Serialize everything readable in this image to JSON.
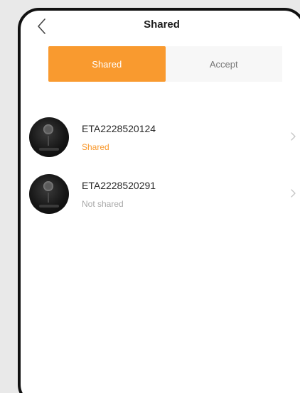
{
  "header": {
    "title": "Shared",
    "back_icon": "chevron-left-icon"
  },
  "tabs": [
    {
      "label": "Shared",
      "active": true
    },
    {
      "label": "Accept",
      "active": false
    }
  ],
  "devices": [
    {
      "name": "ETA2228520124",
      "status": "Shared",
      "status_color": "#f99a2f",
      "icon": "robot-vacuum-icon"
    },
    {
      "name": "ETA2228520291",
      "status": "Not shared",
      "status_color": "#a8a8a8",
      "icon": "robot-vacuum-icon"
    }
  ],
  "colors": {
    "accent": "#f99a2f",
    "tab_bg": "#f7f7f7",
    "text": "#2a2a2a",
    "muted": "#a8a8a8"
  }
}
